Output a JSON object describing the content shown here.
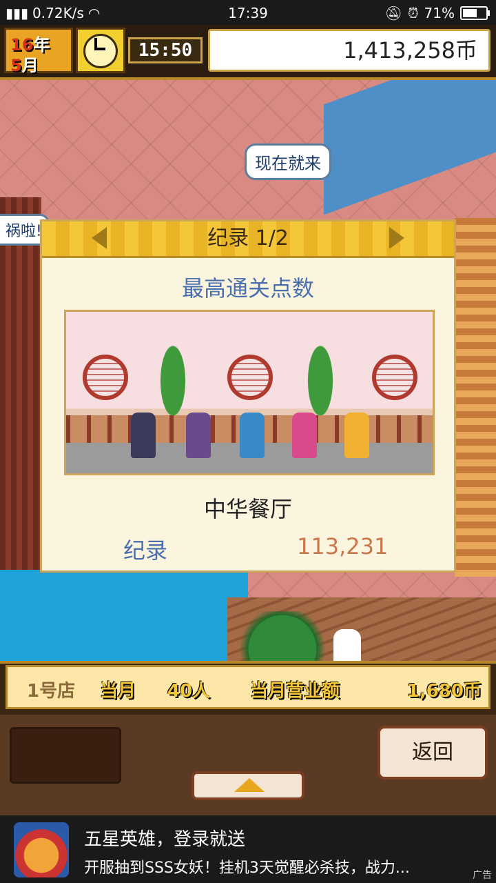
{
  "status_bar": {
    "network": "0.72K/s",
    "time": "17:39",
    "battery": "71%",
    "battery_level": 0.71
  },
  "hud": {
    "year_num": "16",
    "year_unit": "年",
    "month_num": "5",
    "month_unit": "月",
    "game_time": "15:50",
    "coins": "1,413,258币"
  },
  "scene": {
    "speech_bubble": "现在就来",
    "speech_left": "祸啦!"
  },
  "dialog": {
    "title": "纪录 1/2",
    "subtitle": "最高通关点数",
    "dish_name": "中华餐厅",
    "record_label": "纪录",
    "record_value": "113,231"
  },
  "shop_bar": {
    "shop_name": "1号店",
    "month_label": "当月",
    "visitors": "40人",
    "sales_label": "当月营业额",
    "sales_value": "1,680币"
  },
  "controls": {
    "back_label": "返回"
  },
  "ad": {
    "title": "五星英雄，登录就送",
    "description": "开服抽到SSS女妖！挂机3天觉醒必杀技，战力...",
    "tag": "广告"
  },
  "colors": {
    "accent": "#e8b426",
    "record_value": "#c9764a",
    "label_blue": "#4a6fae"
  }
}
